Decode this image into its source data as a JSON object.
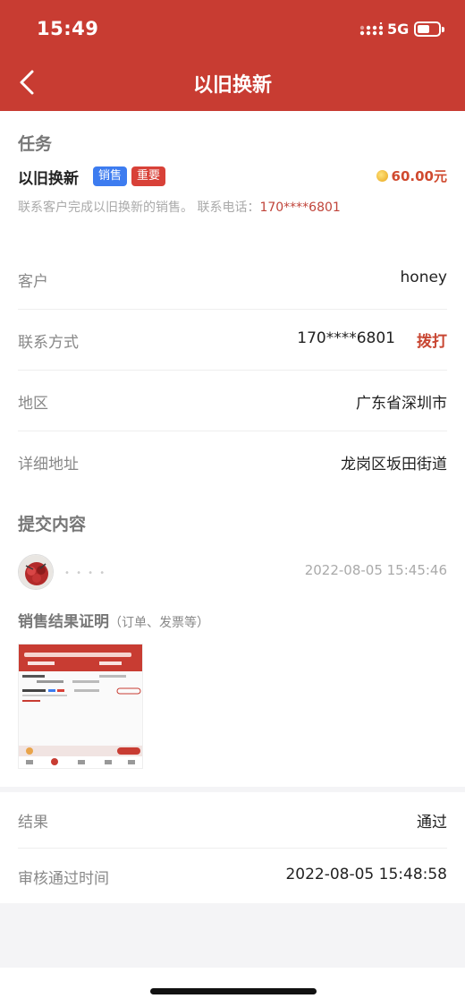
{
  "status_bar": {
    "time": "15:49",
    "network": "5G",
    "battery_level": 0.6
  },
  "nav": {
    "title": "以旧换新"
  },
  "task": {
    "section_title": "任务",
    "name": "以旧换新",
    "tags": [
      "销售",
      "重要"
    ],
    "reward": "60.00元",
    "description": "联系客户完成以旧换新的销售。 联系电话：",
    "phone": "170****6801"
  },
  "info": {
    "customer_label": "客户",
    "customer_value": "honey",
    "contact_label": "联系方式",
    "contact_value": "170****6801",
    "call_label": "拨打",
    "region_label": "地区",
    "region_value": "广东省深圳市",
    "address_label": "详细地址",
    "address_value": "龙岗区坂田街道"
  },
  "submission": {
    "section_title": "提交内容",
    "time": "2022-08-05 15:45:46",
    "proof_title": "销售结果证明",
    "proof_subtitle": "（订单、发票等）"
  },
  "result": {
    "result_label": "结果",
    "result_value": "通过",
    "approved_time_label": "审核通过时间",
    "approved_time_value": "2022-08-05 15:48:58"
  },
  "colors": {
    "header": "#c83c32",
    "tag_sale": "#3d7cf0",
    "tag_important": "#d84138",
    "accent": "#c84632"
  }
}
